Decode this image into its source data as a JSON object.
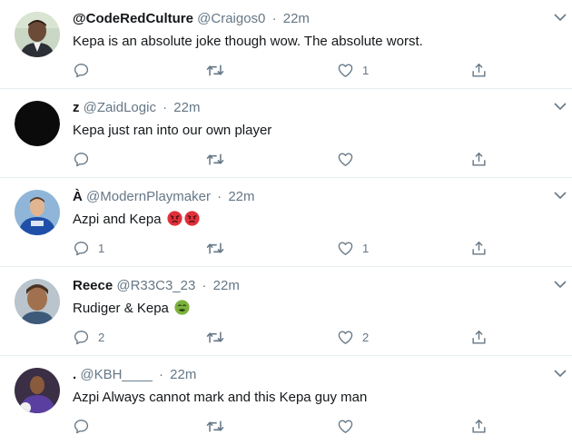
{
  "tweets": [
    {
      "name": "@CodeRedCulture",
      "handle": "@Craigos0",
      "time": "22m",
      "text": "Kepa is an absolute joke though wow. The absolute worst.",
      "reply_count": "",
      "like_count": "1",
      "emoji": []
    },
    {
      "name": "z",
      "handle": "@ZaidLogic",
      "time": "22m",
      "text": "Kepa just ran into our own player",
      "reply_count": "",
      "like_count": "",
      "emoji": []
    },
    {
      "name": "À",
      "handle": "@ModernPlaymaker",
      "time": "22m",
      "text": "Azpi and Kepa",
      "reply_count": "1",
      "like_count": "1",
      "emoji": [
        "angry-face-emoji",
        "angry-face-emoji"
      ]
    },
    {
      "name": "Reece",
      "handle": "@R33C3_23",
      "time": "22m",
      "text": "Rudiger & Kepa",
      "reply_count": "2",
      "like_count": "2",
      "emoji": [
        "nauseated-face-emoji"
      ]
    },
    {
      "name": ".",
      "handle": "@KBH____",
      "time": "22m",
      "text": "Azpi Always cannot mark and this Kepa guy man",
      "reply_count": "",
      "like_count": "",
      "emoji": []
    }
  ],
  "separator": "·",
  "icons": {
    "reply": "reply-icon",
    "retweet": "retweet-icon",
    "like": "heart-icon",
    "share": "share-icon",
    "menu": "chevron-down-icon"
  },
  "colors": {
    "text": "#14171a",
    "secondary": "#657786",
    "border": "#e6ecf0",
    "angry": "#e0303a",
    "nauseated": "#7bb13c"
  }
}
